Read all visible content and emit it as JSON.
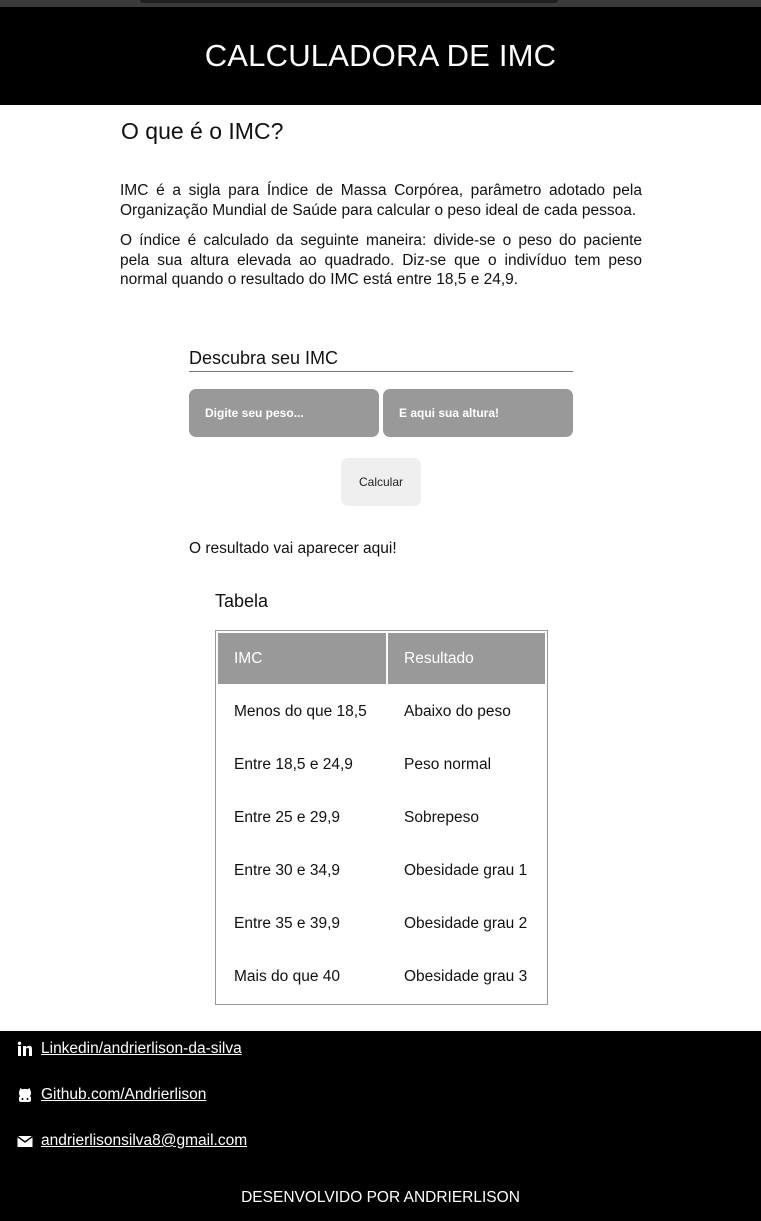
{
  "header": {
    "title": "CALCULADORA DE IMC"
  },
  "intro": {
    "heading": "O que é o IMC?",
    "paragraph1": "IMC é a sigla para Índice de Massa Corpórea, parâmetro adotado pela Organização Mundial de Saúde para calcular o peso ideal de cada pessoa.",
    "paragraph2": "O índice é calculado da seguinte maneira: divide-se o peso do paciente pela sua altura elevada ao quadrado. Diz-se que o indivíduo tem peso normal quando o resultado do IMC está entre 18,5 e 24,9."
  },
  "calculator": {
    "title": "Descubra seu IMC",
    "weight_placeholder": "Digite seu peso...",
    "height_placeholder": "E aqui sua altura!",
    "button_label": "Calcular",
    "result_text": "O resultado vai aparecer aqui!"
  },
  "table": {
    "title": "Tabela",
    "headers": [
      "IMC",
      "Resultado"
    ],
    "rows": [
      [
        "Menos do que 18,5",
        "Abaixo do peso"
      ],
      [
        "Entre 18,5 e 24,9",
        "Peso normal"
      ],
      [
        "Entre 25 e 29,9",
        "Sobrepeso"
      ],
      [
        "Entre 30 e 34,9",
        "Obesidade grau 1"
      ],
      [
        "Entre 35 e 39,9",
        "Obesidade grau 2"
      ],
      [
        "Mais do que 40",
        "Obesidade grau 3"
      ]
    ]
  },
  "footer": {
    "linkedin": {
      "icon": "linkedin-icon",
      "label": "Linkedin/andrierlison-da-silva"
    },
    "github": {
      "icon": "github-icon",
      "label": "Github.com/Andrierlison"
    },
    "email": {
      "icon": "envelope-icon",
      "label": "andrierlisonsilva8@gmail.com"
    },
    "credit": "DESENVOLVIDO POR ANDRIERLISON"
  },
  "colors": {
    "header_bg": "#000000",
    "footer_bg": "#000000",
    "input_bg": "#999999",
    "button_bg": "#efefef",
    "table_header_bg": "#999999"
  }
}
